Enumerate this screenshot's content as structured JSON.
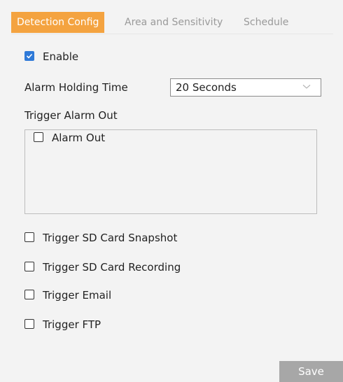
{
  "tabs": [
    {
      "label": "Detection Config",
      "active": true
    },
    {
      "label": "Area and Sensitivity",
      "active": false
    },
    {
      "label": "Schedule",
      "active": false
    }
  ],
  "enable": {
    "label": "Enable",
    "checked": true
  },
  "alarm_holding_time": {
    "label": "Alarm Holding Time",
    "value": "20 Seconds"
  },
  "trigger_alarm_out": {
    "label": "Trigger Alarm Out",
    "items": [
      {
        "label": "Alarm Out",
        "checked": false
      }
    ]
  },
  "triggers": [
    {
      "label": "Trigger SD Card Snapshot",
      "checked": false
    },
    {
      "label": "Trigger SD Card Recording",
      "checked": false
    },
    {
      "label": "Trigger Email",
      "checked": false
    },
    {
      "label": "Trigger FTP",
      "checked": false
    }
  ],
  "save_label": "Save",
  "colors": {
    "accent": "#f4a340",
    "checkbox_checked": "#2f7ad8",
    "save_button": "#a7a7a7"
  },
  "icons": {
    "checkmark": "check-icon",
    "dropdown": "chevron-down-icon"
  }
}
